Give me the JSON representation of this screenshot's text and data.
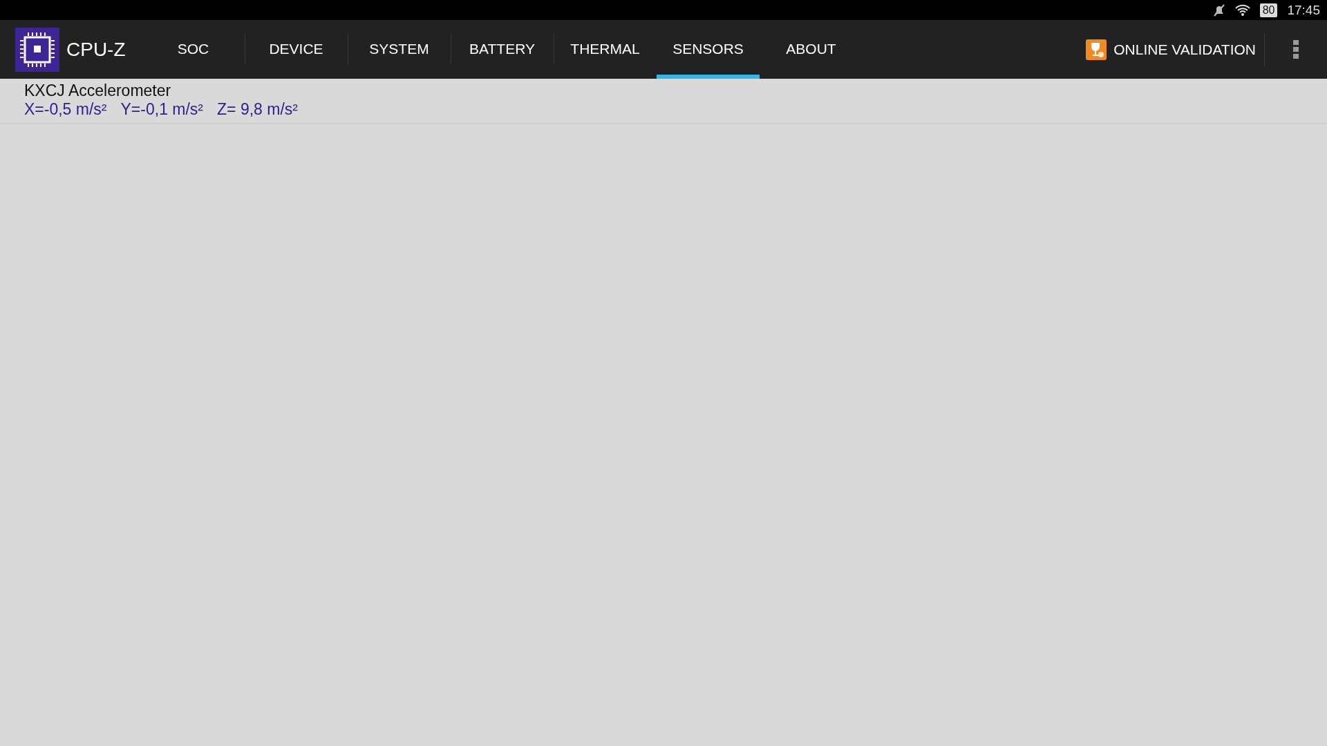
{
  "status_bar": {
    "battery": "80",
    "time": "17:45"
  },
  "app_bar": {
    "title": "CPU-Z",
    "validation": "ONLINE VALIDATION"
  },
  "tabs": [
    {
      "label": "SOC",
      "selected": false
    },
    {
      "label": "DEVICE",
      "selected": false
    },
    {
      "label": "SYSTEM",
      "selected": false
    },
    {
      "label": "BATTERY",
      "selected": false
    },
    {
      "label": "THERMAL",
      "selected": false
    },
    {
      "label": "SENSORS",
      "selected": true
    },
    {
      "label": "ABOUT",
      "selected": false
    }
  ],
  "sensors": [
    {
      "name": "KXCJ Accelerometer",
      "readings": [
        "X=-0,5 m/s²",
        "Y=-0,1 m/s²",
        "Z= 9,8 m/s²"
      ]
    }
  ]
}
